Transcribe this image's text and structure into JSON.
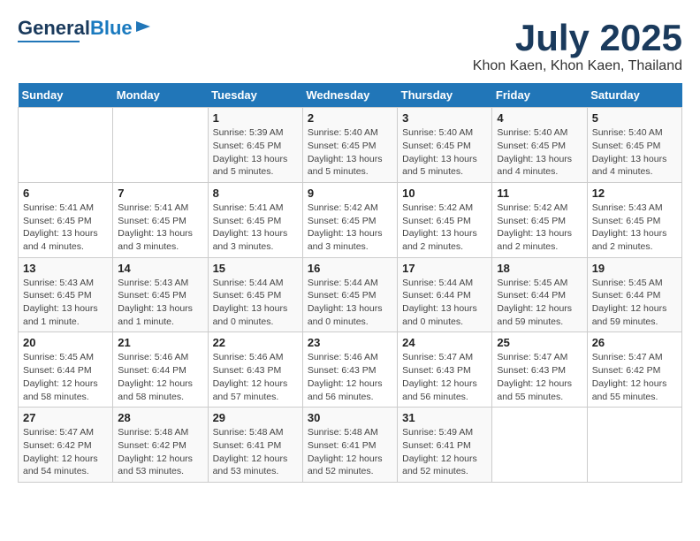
{
  "header": {
    "logo_line1": "General",
    "logo_line2": "Blue",
    "month": "July 2025",
    "location": "Khon Kaen, Khon Kaen, Thailand"
  },
  "weekdays": [
    "Sunday",
    "Monday",
    "Tuesday",
    "Wednesday",
    "Thursday",
    "Friday",
    "Saturday"
  ],
  "weeks": [
    [
      {
        "day": "",
        "detail": ""
      },
      {
        "day": "",
        "detail": ""
      },
      {
        "day": "1",
        "detail": "Sunrise: 5:39 AM\nSunset: 6:45 PM\nDaylight: 13 hours and 5 minutes."
      },
      {
        "day": "2",
        "detail": "Sunrise: 5:40 AM\nSunset: 6:45 PM\nDaylight: 13 hours and 5 minutes."
      },
      {
        "day": "3",
        "detail": "Sunrise: 5:40 AM\nSunset: 6:45 PM\nDaylight: 13 hours and 5 minutes."
      },
      {
        "day": "4",
        "detail": "Sunrise: 5:40 AM\nSunset: 6:45 PM\nDaylight: 13 hours and 4 minutes."
      },
      {
        "day": "5",
        "detail": "Sunrise: 5:40 AM\nSunset: 6:45 PM\nDaylight: 13 hours and 4 minutes."
      }
    ],
    [
      {
        "day": "6",
        "detail": "Sunrise: 5:41 AM\nSunset: 6:45 PM\nDaylight: 13 hours and 4 minutes."
      },
      {
        "day": "7",
        "detail": "Sunrise: 5:41 AM\nSunset: 6:45 PM\nDaylight: 13 hours and 3 minutes."
      },
      {
        "day": "8",
        "detail": "Sunrise: 5:41 AM\nSunset: 6:45 PM\nDaylight: 13 hours and 3 minutes."
      },
      {
        "day": "9",
        "detail": "Sunrise: 5:42 AM\nSunset: 6:45 PM\nDaylight: 13 hours and 3 minutes."
      },
      {
        "day": "10",
        "detail": "Sunrise: 5:42 AM\nSunset: 6:45 PM\nDaylight: 13 hours and 2 minutes."
      },
      {
        "day": "11",
        "detail": "Sunrise: 5:42 AM\nSunset: 6:45 PM\nDaylight: 13 hours and 2 minutes."
      },
      {
        "day": "12",
        "detail": "Sunrise: 5:43 AM\nSunset: 6:45 PM\nDaylight: 13 hours and 2 minutes."
      }
    ],
    [
      {
        "day": "13",
        "detail": "Sunrise: 5:43 AM\nSunset: 6:45 PM\nDaylight: 13 hours and 1 minute."
      },
      {
        "day": "14",
        "detail": "Sunrise: 5:43 AM\nSunset: 6:45 PM\nDaylight: 13 hours and 1 minute."
      },
      {
        "day": "15",
        "detail": "Sunrise: 5:44 AM\nSunset: 6:45 PM\nDaylight: 13 hours and 0 minutes."
      },
      {
        "day": "16",
        "detail": "Sunrise: 5:44 AM\nSunset: 6:45 PM\nDaylight: 13 hours and 0 minutes."
      },
      {
        "day": "17",
        "detail": "Sunrise: 5:44 AM\nSunset: 6:44 PM\nDaylight: 13 hours and 0 minutes."
      },
      {
        "day": "18",
        "detail": "Sunrise: 5:45 AM\nSunset: 6:44 PM\nDaylight: 12 hours and 59 minutes."
      },
      {
        "day": "19",
        "detail": "Sunrise: 5:45 AM\nSunset: 6:44 PM\nDaylight: 12 hours and 59 minutes."
      }
    ],
    [
      {
        "day": "20",
        "detail": "Sunrise: 5:45 AM\nSunset: 6:44 PM\nDaylight: 12 hours and 58 minutes."
      },
      {
        "day": "21",
        "detail": "Sunrise: 5:46 AM\nSunset: 6:44 PM\nDaylight: 12 hours and 58 minutes."
      },
      {
        "day": "22",
        "detail": "Sunrise: 5:46 AM\nSunset: 6:43 PM\nDaylight: 12 hours and 57 minutes."
      },
      {
        "day": "23",
        "detail": "Sunrise: 5:46 AM\nSunset: 6:43 PM\nDaylight: 12 hours and 56 minutes."
      },
      {
        "day": "24",
        "detail": "Sunrise: 5:47 AM\nSunset: 6:43 PM\nDaylight: 12 hours and 56 minutes."
      },
      {
        "day": "25",
        "detail": "Sunrise: 5:47 AM\nSunset: 6:43 PM\nDaylight: 12 hours and 55 minutes."
      },
      {
        "day": "26",
        "detail": "Sunrise: 5:47 AM\nSunset: 6:42 PM\nDaylight: 12 hours and 55 minutes."
      }
    ],
    [
      {
        "day": "27",
        "detail": "Sunrise: 5:47 AM\nSunset: 6:42 PM\nDaylight: 12 hours and 54 minutes."
      },
      {
        "day": "28",
        "detail": "Sunrise: 5:48 AM\nSunset: 6:42 PM\nDaylight: 12 hours and 53 minutes."
      },
      {
        "day": "29",
        "detail": "Sunrise: 5:48 AM\nSunset: 6:41 PM\nDaylight: 12 hours and 53 minutes."
      },
      {
        "day": "30",
        "detail": "Sunrise: 5:48 AM\nSunset: 6:41 PM\nDaylight: 12 hours and 52 minutes."
      },
      {
        "day": "31",
        "detail": "Sunrise: 5:49 AM\nSunset: 6:41 PM\nDaylight: 12 hours and 52 minutes."
      },
      {
        "day": "",
        "detail": ""
      },
      {
        "day": "",
        "detail": ""
      }
    ]
  ]
}
